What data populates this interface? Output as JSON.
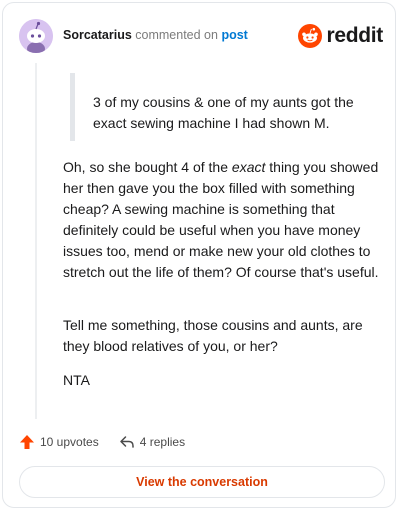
{
  "header": {
    "username": "Sorcatarius",
    "verb": "commented on",
    "post_link": "post",
    "brand": "reddit"
  },
  "quote": "3 of my cousins & one of my aunts got the exact sewing machine I had shown M.",
  "body": {
    "p1_before": "Oh, so she bought 4 of the ",
    "p1_em": "exact",
    "p1_after": " thing you showed her then gave you the box filled with something cheap? A sewing machine is something that definitely could be useful when you have money issues too, mend or make new your old clothes to stretch out the life of them? Of course that's useful.",
    "p2": "Tell me something, those cousins and aunts, are they blood relatives of you, or her?",
    "p3": "NTA"
  },
  "actions": {
    "upvotes": "10 upvotes",
    "replies": "4 replies"
  },
  "cta": "View the conversation",
  "colors": {
    "brand_orange": "#ff4500",
    "link_blue": "#0079d3",
    "cta_text": "#d93a00"
  },
  "icons": {
    "avatar": "snoo-avatar",
    "brand": "reddit-logo-icon",
    "upvote": "upvote-arrow-icon",
    "reply": "reply-arrow-icon"
  }
}
